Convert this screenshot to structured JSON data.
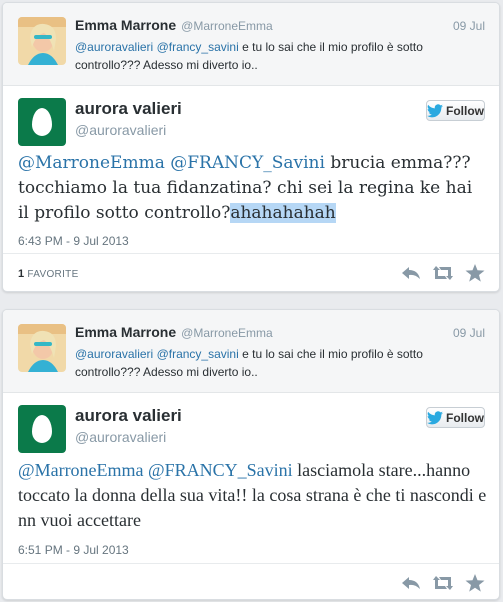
{
  "tweets": [
    {
      "parent": {
        "name": "Emma Marrone",
        "handle": "@MarroneEmma",
        "date": "09 Jul",
        "mention1": "@auroravalieri",
        "mention2": "@francy_savini",
        "text": " e tu lo sai che il mio profilo è sotto controllo??? Adesso mi diverto io.."
      },
      "author": {
        "name": "aurora valieri",
        "handle": "@auroravalieri"
      },
      "follow_label": "Follow",
      "body": {
        "mentions": "@MarroneEmma @FRANCY_Savini",
        "text": "  brucia emma??? tocchiamo la tua fidanzatina? chi sei la regina ke hai il profilo sotto controllo?",
        "highlighted": "ahahahahah"
      },
      "time": "6:43 PM - 9 Jul 2013",
      "favorites": {
        "count": "1",
        "label": "FAVORITE"
      }
    },
    {
      "parent": {
        "name": "Emma Marrone",
        "handle": "@MarroneEmma",
        "date": "09 Jul",
        "mention1": "@auroravalieri",
        "mention2": "@francy_savini",
        "text": " e tu lo sai che il mio profilo è sotto controllo??? Adesso mi diverto io.."
      },
      "author": {
        "name": "aurora valieri",
        "handle": "@auroravalieri"
      },
      "follow_label": "Follow",
      "body": {
        "mentions": "@MarroneEmma @FRANCY_Savini",
        "text": " lasciamola stare...hanno toccato la donna della sua vita!! la cosa strana è che ti nascondi e nn vuoi accettare",
        "highlighted": ""
      },
      "time": "6:51 PM - 9 Jul 2013"
    }
  ],
  "icons": {
    "reply": "reply-icon",
    "retweet": "retweet-icon",
    "favorite": "star-icon",
    "bird": "twitter-bird-icon"
  },
  "colors": {
    "link": "#2a73a8",
    "highlight": "#b6d7f5",
    "avatar_bg": "#0b7a4a"
  }
}
